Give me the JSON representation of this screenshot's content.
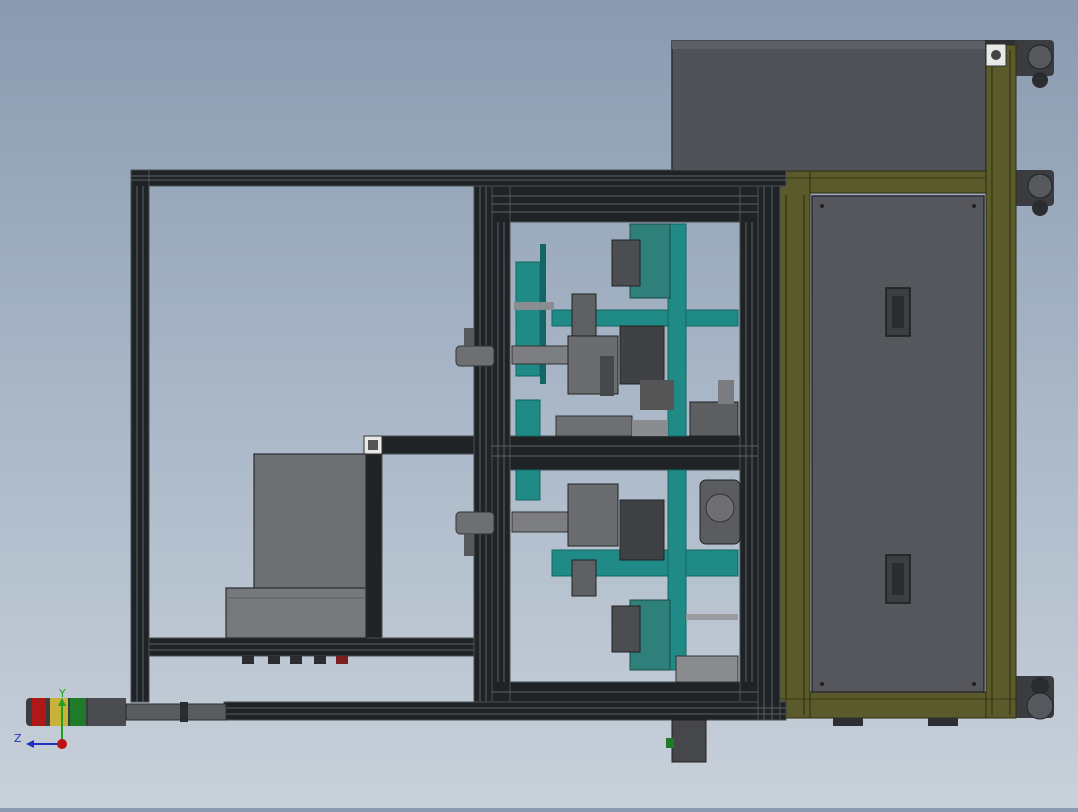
{
  "view": {
    "background_top": "#8a9bb0",
    "background_bottom": "#c9d1da"
  },
  "colors": {
    "frame": "#1f2326",
    "frame_edge": "#4a4f55",
    "panel": "#55575c",
    "cabinet": "#4f5359",
    "olive_rail": "#5a5a2a",
    "teal": "#1f8a86",
    "teal_dark": "#136663",
    "grey_block": "#6d6f72",
    "light_grey": "#9a9c9f",
    "caster": "#3a3c40",
    "signal_red": "#b01818",
    "signal_yellow": "#c9b23a",
    "signal_green": "#1f7a2a"
  },
  "triad": {
    "y_label": "Y",
    "z_label": "Z",
    "y_axis_color": "#20a020",
    "z_axis_color": "#2030c0",
    "x_dot_color": "#c01010"
  }
}
